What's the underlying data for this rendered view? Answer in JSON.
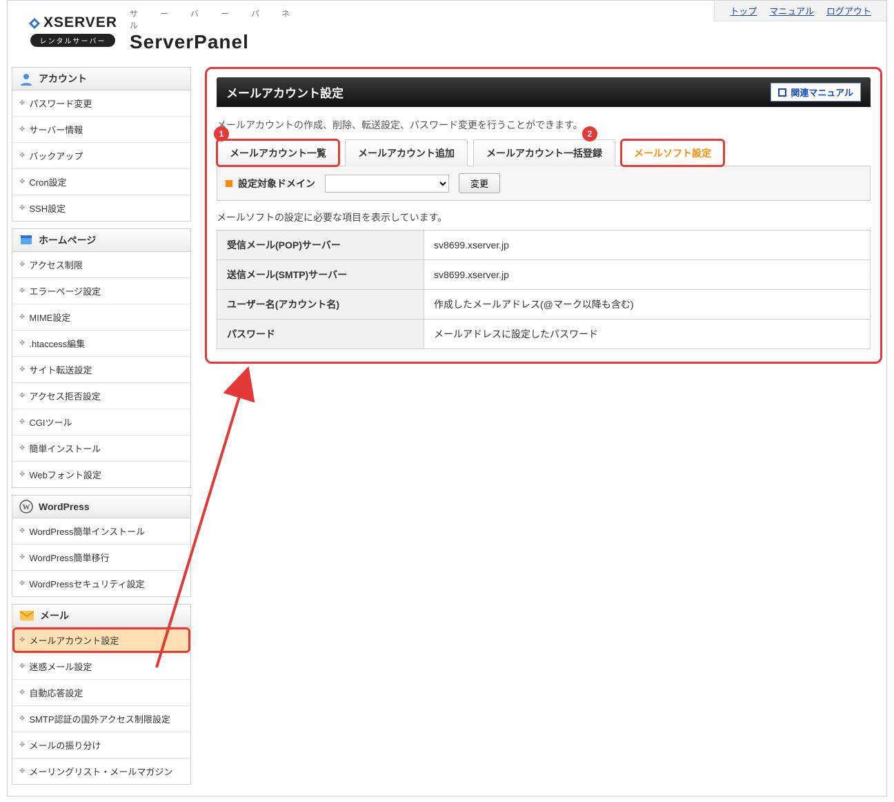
{
  "header": {
    "brand_text": "XSERVER",
    "brand_pill": "レンタルサーバー",
    "sp_kana": "サ　ー　バ　ー　パ　ネ　ル",
    "sp_text": "ServerPanel",
    "links": {
      "top": "トップ",
      "manual": "マニュアル",
      "logout": "ログアウト"
    }
  },
  "sidebar": {
    "sections": [
      {
        "title": "アカウント",
        "icon": "user",
        "items": [
          "パスワード変更",
          "サーバー情報",
          "バックアップ",
          "Cron設定",
          "SSH設定"
        ]
      },
      {
        "title": "ホームページ",
        "icon": "page",
        "items": [
          "アクセス制限",
          "エラーページ設定",
          "MIME設定",
          ".htaccess編集",
          "サイト転送設定",
          "アクセス拒否設定",
          "CGIツール",
          "簡単インストール",
          "Webフォント設定"
        ]
      },
      {
        "title": "WordPress",
        "icon": "wp",
        "items": [
          "WordPress簡単インストール",
          "WordPress簡単移行",
          "WordPressセキュリティ設定"
        ]
      },
      {
        "title": "メール",
        "icon": "mail",
        "items": [
          "メールアカウント設定",
          "迷惑メール設定",
          "自動応答設定",
          "SMTP認証の国外アクセス制限設定",
          "メールの振り分け",
          "メーリングリスト・メールマガジン"
        ],
        "active_index": 0
      }
    ]
  },
  "panel": {
    "title": "メールアカウント設定",
    "manual_button": "関連マニュアル",
    "description": "メールアカウントの作成、削除、転送設定、パスワード変更を行うことができます。",
    "tabs": [
      "メールアカウント一覧",
      "メールアカウント追加",
      "メールアカウント一括登録",
      "メールソフト設定"
    ],
    "active_tab_index": 3,
    "badge1": "1",
    "badge2": "2",
    "domain_label": "設定対象ドメイン",
    "change_button": "変更",
    "description2": "メールソフトの設定に必要な項目を表示しています。",
    "rows": [
      {
        "label": "受信メール(POP)サーバー",
        "value": "sv8699.xserver.jp"
      },
      {
        "label": "送信メール(SMTP)サーバー",
        "value": "sv8699.xserver.jp"
      },
      {
        "label": "ユーザー名(アカウント名)",
        "value": "作成したメールアドレス(@マーク以降も含む)"
      },
      {
        "label": "パスワード",
        "value": "メールアドレスに設定したパスワード"
      }
    ]
  }
}
